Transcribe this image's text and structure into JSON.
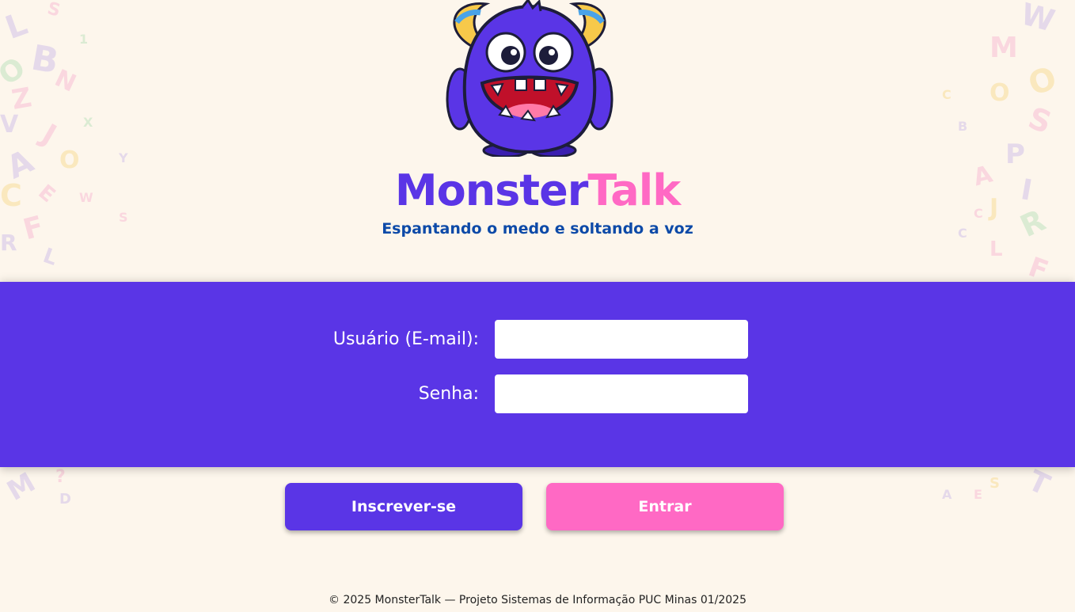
{
  "app": {
    "brand_part1": "Monster",
    "brand_part2": "Talk",
    "tagline": "Espantando o medo e soltando a voz"
  },
  "login_form": {
    "email_label": "Usuário (E-mail):",
    "email_value": "",
    "password_label": "Senha:",
    "password_value": ""
  },
  "actions": {
    "signup_label": "Inscrever-se",
    "login_label": "Entrar"
  },
  "footer": {
    "text": "© 2025 MonsterTalk — Projeto Sistemas de Informação PUC Minas 01/2025"
  },
  "colors": {
    "background": "#fdf6ec",
    "primary_purple": "#5a35e6",
    "accent_pink": "#ff69c4",
    "tagline_blue": "#0d4aa8"
  },
  "icons": {
    "mascot": "purple-monster-mascot",
    "background_pattern": "colorful-alphabet-letters"
  }
}
